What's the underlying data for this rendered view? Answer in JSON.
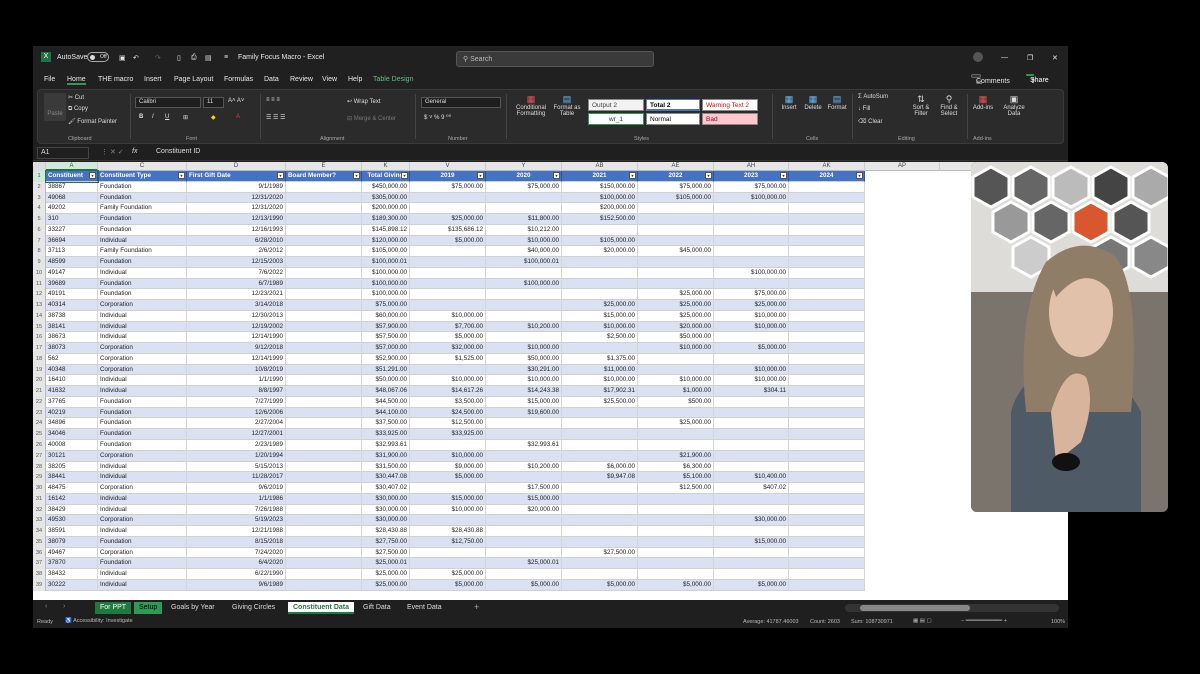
{
  "window": {
    "autosave": "AutoSave",
    "autosave_state": "Off",
    "title": "Family Focus Macro - Excel",
    "search_placeholder": "Search"
  },
  "menu": [
    "File",
    "Home",
    "THE macro",
    "Insert",
    "Page Layout",
    "Formulas",
    "Data",
    "Review",
    "View",
    "Help",
    "Table Design"
  ],
  "menu_buttons": {
    "comments": "Comments",
    "share": "Share"
  },
  "ribbon": {
    "clipboard": {
      "paste": "Paste",
      "cut": "Cut",
      "copy": "Copy",
      "format_painter": "Format Painter",
      "label": "Clipboard"
    },
    "font": {
      "name": "Calibri",
      "size": "11",
      "label": "Font"
    },
    "alignment": {
      "wrap": "Wrap Text",
      "merge": "Merge & Center",
      "label": "Alignment"
    },
    "number": {
      "format": "General",
      "label": "Number"
    },
    "styles": {
      "cond": "Conditional Formatting",
      "table": "Format as Table",
      "items": [
        "Output 2",
        "Total 2",
        "Warning Text 2",
        "wr_1",
        "Normal",
        "Bad"
      ],
      "label": "Styles"
    },
    "cells": {
      "insert": "Insert",
      "delete": "Delete",
      "format": "Format",
      "label": "Cells"
    },
    "editing": {
      "autosum": "AutoSum",
      "fill": "Fill",
      "clear": "Clear",
      "sort": "Sort & Filter",
      "find": "Find & Select",
      "label": "Editing"
    },
    "addins": {
      "addins": "Add-ins",
      "analyze": "Analyze Data",
      "label": "Add-ins"
    }
  },
  "formula_bar": {
    "cell": "A1",
    "fx": "fx",
    "content": "Constituent ID"
  },
  "columns": [
    "A",
    "C",
    "D",
    "E",
    "K",
    "V",
    "Y",
    "AB",
    "AE",
    "AH",
    "AK",
    "AP"
  ],
  "headers": [
    "Constituent",
    "Constituent Type",
    "First Gift Date",
    "Board Member?",
    "Total Giving",
    "2019",
    "2020",
    "2021",
    "2022",
    "2023",
    "2024"
  ],
  "rows": [
    [
      "38867",
      "Foundation",
      "9/1/1989",
      "",
      "$450,000.00",
      "$75,000.00",
      "$75,000.00",
      "$150,000.00",
      "$75,000.00",
      "$75,000.00",
      ""
    ],
    [
      "49068",
      "Foundation",
      "12/31/2020",
      "",
      "$305,000.00",
      "",
      "",
      "$100,000.00",
      "$105,000.00",
      "$100,000.00",
      ""
    ],
    [
      "49202",
      "Family Foundation",
      "12/31/2020",
      "",
      "$200,000.00",
      "",
      "",
      "$200,000.00",
      "",
      "",
      ""
    ],
    [
      "310",
      "Foundation",
      "12/13/1990",
      "",
      "$189,300.00",
      "$25,000.00",
      "$11,800.00",
      "$152,500.00",
      "",
      "",
      ""
    ],
    [
      "33227",
      "Foundation",
      "12/16/1993",
      "",
      "$145,898.12",
      "$135,686.12",
      "$10,212.00",
      "",
      "",
      "",
      ""
    ],
    [
      "36694",
      "Individual",
      "6/28/2010",
      "",
      "$120,000.00",
      "$5,000.00",
      "$10,000.00",
      "$105,000.00",
      "",
      "",
      ""
    ],
    [
      "37113",
      "Family Foundation",
      "2/6/2012",
      "",
      "$105,000.00",
      "",
      "$40,000.00",
      "$20,000.00",
      "$45,000.00",
      "",
      ""
    ],
    [
      "48599",
      "Foundation",
      "12/15/2003",
      "",
      "$100,000.01",
      "",
      "$100,000.01",
      "",
      "",
      "",
      ""
    ],
    [
      "49147",
      "Individual",
      "7/6/2022",
      "",
      "$100,000.00",
      "",
      "",
      "",
      "",
      "$100,000.00",
      ""
    ],
    [
      "39689",
      "Foundation",
      "6/7/1989",
      "",
      "$100,000.00",
      "",
      "$100,000.00",
      "",
      "",
      "",
      ""
    ],
    [
      "49191",
      "Foundation",
      "12/23/2021",
      "",
      "$100,000.00",
      "",
      "",
      "",
      "$25,000.00",
      "$75,000.00",
      ""
    ],
    [
      "40314",
      "Corporation",
      "3/14/2018",
      "",
      "$75,000.00",
      "",
      "",
      "$25,000.00",
      "$25,000.00",
      "$25,000.00",
      ""
    ],
    [
      "38738",
      "Individual",
      "12/30/2013",
      "",
      "$60,000.00",
      "$10,000.00",
      "",
      "$15,000.00",
      "$25,000.00",
      "$10,000.00",
      ""
    ],
    [
      "38141",
      "Individual",
      "12/19/2002",
      "",
      "$57,900.00",
      "$7,700.00",
      "$10,200.00",
      "$10,000.00",
      "$20,000.00",
      "$10,000.00",
      ""
    ],
    [
      "38673",
      "Individual",
      "12/14/1990",
      "",
      "$57,500.00",
      "$5,000.00",
      "",
      "$2,500.00",
      "$50,000.00",
      "",
      ""
    ],
    [
      "38073",
      "Corporation",
      "9/12/2018",
      "",
      "$57,000.00",
      "$32,000.00",
      "$10,000.00",
      "",
      "$10,000.00",
      "$5,000.00",
      ""
    ],
    [
      "562",
      "Corporation",
      "12/14/1999",
      "",
      "$52,900.00",
      "$1,525.00",
      "$50,000.00",
      "$1,375.00",
      "",
      "",
      ""
    ],
    [
      "40348",
      "Corporation",
      "10/8/2019",
      "",
      "$51,291.00",
      "",
      "$30,291.00",
      "$11,000.00",
      "",
      "$10,000.00",
      ""
    ],
    [
      "16410",
      "Individual",
      "1/1/1990",
      "",
      "$50,000.00",
      "$10,000.00",
      "$10,000.00",
      "$10,000.00",
      "$10,000.00",
      "$10,000.00",
      ""
    ],
    [
      "41632",
      "Individual",
      "8/8/1997",
      "",
      "$48,067.06",
      "$14,617.26",
      "$14,243.38",
      "$17,902.31",
      "$1,000.00",
      "$304.11",
      ""
    ],
    [
      "37765",
      "Foundation",
      "7/27/1999",
      "",
      "$44,500.00",
      "$3,500.00",
      "$15,000.00",
      "$25,500.00",
      "$500.00",
      "",
      ""
    ],
    [
      "40219",
      "Foundation",
      "12/6/2006",
      "",
      "$44,100.00",
      "$24,500.00",
      "$19,600.00",
      "",
      "",
      "",
      ""
    ],
    [
      "34896",
      "Foundation",
      "2/27/2004",
      "",
      "$37,500.00",
      "$12,500.00",
      "",
      "",
      "$25,000.00",
      "",
      ""
    ],
    [
      "34046",
      "Foundation",
      "12/27/2001",
      "",
      "$33,925.00",
      "$33,925.00",
      "",
      "",
      "",
      "",
      ""
    ],
    [
      "40008",
      "Foundation",
      "2/23/1989",
      "",
      "$32,993.61",
      "",
      "$32,993.61",
      "",
      "",
      "",
      ""
    ],
    [
      "30121",
      "Corporation",
      "1/20/1994",
      "",
      "$31,900.00",
      "$10,000.00",
      "",
      "",
      "$21,900.00",
      "",
      ""
    ],
    [
      "38205",
      "Individual",
      "5/15/2013",
      "",
      "$31,500.00",
      "$9,000.00",
      "$10,200.00",
      "$6,000.00",
      "$6,300.00",
      "",
      ""
    ],
    [
      "38441",
      "Individual",
      "11/28/2017",
      "",
      "$30,447.08",
      "$5,000.00",
      "",
      "$9,947.08",
      "$5,100.00",
      "$10,400.00",
      ""
    ],
    [
      "48475",
      "Corporation",
      "9/6/2019",
      "",
      "$30,407.02",
      "",
      "$17,500.00",
      "",
      "$12,500.00",
      "$407.02",
      ""
    ],
    [
      "16142",
      "Individual",
      "1/1/1986",
      "",
      "$30,000.00",
      "$15,000.00",
      "$15,000.00",
      "",
      "",
      "",
      ""
    ],
    [
      "38429",
      "Individual",
      "7/26/1988",
      "",
      "$30,000.00",
      "$10,000.00",
      "$20,000.00",
      "",
      "",
      "",
      ""
    ],
    [
      "49530",
      "Corporation",
      "5/19/2023",
      "",
      "$30,000.00",
      "",
      "",
      "",
      "",
      "$30,000.00",
      ""
    ],
    [
      "38591",
      "Individual",
      "12/21/1988",
      "",
      "$28,430.88",
      "$28,430.88",
      "",
      "",
      "",
      "",
      ""
    ],
    [
      "38079",
      "Foundation",
      "8/15/2018",
      "",
      "$27,750.00",
      "$12,750.00",
      "",
      "",
      "",
      "$15,000.00",
      ""
    ],
    [
      "49467",
      "Corporation",
      "7/24/2020",
      "",
      "$27,500.00",
      "",
      "",
      "$27,500.00",
      "",
      "",
      ""
    ],
    [
      "37870",
      "Foundation",
      "6/4/2020",
      "",
      "$25,000.01",
      "",
      "$25,000.01",
      "",
      "",
      "",
      ""
    ],
    [
      "38432",
      "Individual",
      "6/22/1990",
      "",
      "$25,000.00",
      "$25,000.00",
      "",
      "",
      "",
      "",
      ""
    ],
    [
      "30222",
      "Individual",
      "9/6/1989",
      "",
      "$25,000.00",
      "$5,000.00",
      "$5,000.00",
      "$5,000.00",
      "$5,000.00",
      "$5,000.00",
      ""
    ]
  ],
  "sheet_tabs": [
    "For PPT",
    "Setup",
    "Goals by Year",
    "Giving Circles",
    "Constituent Data",
    "Gift Data",
    "Event Data"
  ],
  "active_tab": "Constituent Data",
  "status": {
    "ready": "Ready",
    "accessibility": "Accessibility: Investigate",
    "average": "Average: 41787.46003",
    "count": "Count: 2603",
    "sum": "Sum: 108730971",
    "zoom": "100%"
  }
}
